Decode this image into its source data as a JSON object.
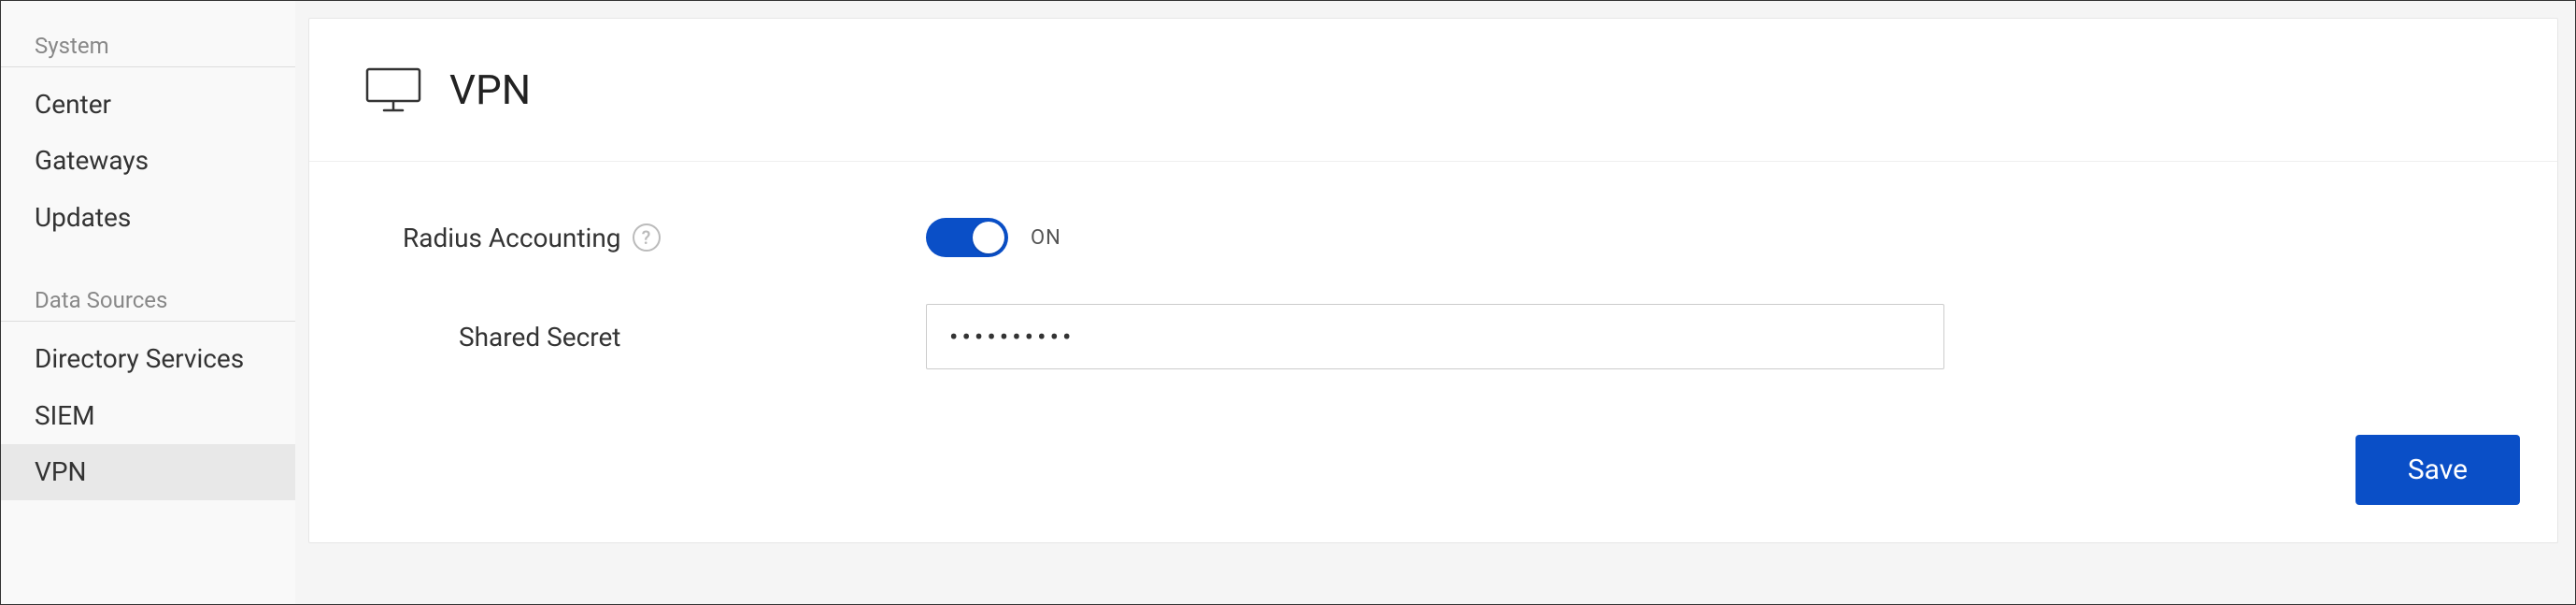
{
  "sidebar": {
    "groups": [
      {
        "header": "System",
        "items": [
          {
            "label": "Center",
            "active": false
          },
          {
            "label": "Gateways",
            "active": false
          },
          {
            "label": "Updates",
            "active": false
          }
        ]
      },
      {
        "header": "Data Sources",
        "items": [
          {
            "label": "Directory Services",
            "active": false
          },
          {
            "label": "SIEM",
            "active": false
          },
          {
            "label": "VPN",
            "active": true
          }
        ]
      }
    ]
  },
  "page": {
    "title": "VPN"
  },
  "form": {
    "radius_accounting_label": "Radius Accounting",
    "toggle_state_label": "ON",
    "shared_secret_label": "Shared Secret",
    "shared_secret_value": "••••••••••"
  },
  "actions": {
    "save_label": "Save"
  }
}
